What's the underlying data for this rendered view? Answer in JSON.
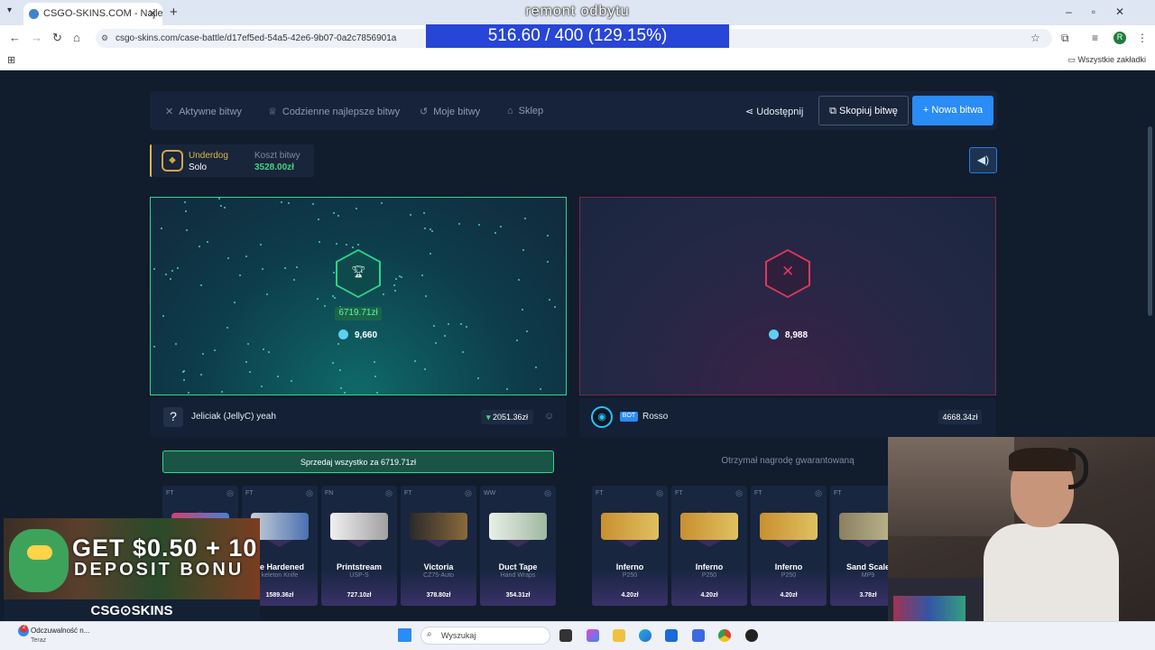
{
  "browser": {
    "tab_title": "CSGO-SKINS.COM - Najlepsze",
    "url": "csgo-skins.com/case-battle/d17ef5ed-54a5-42e6-9b07-0a2c7856901a",
    "bookmarks_label": "Wszystkie zakładki",
    "profile_initial": "R"
  },
  "overlay": {
    "title": "remont odbytu",
    "progress_text": "516.60 / 400 (129.15%)"
  },
  "nav": {
    "items": [
      "Aktywne bitwy",
      "Codzienne najlepsze bitwy",
      "Moje bitwy",
      "Sklep"
    ],
    "share": "Udostępnij",
    "copy": "Skopiuj bitwę",
    "new_battle": "Nowa bitwa"
  },
  "mode": {
    "title": "Underdog",
    "sub": "Solo",
    "cost_label": "Koszt bitwy",
    "cost_value": "3528.00zł"
  },
  "winner": {
    "amount": "6719.71zł",
    "coins": "9,660"
  },
  "loser": {
    "coins": "8,988"
  },
  "player1": {
    "avatar": "?",
    "name": "Jeliciak (JellyC) yeah",
    "value": "2051.36zł"
  },
  "player2": {
    "badge": "BOT",
    "name": "Rosso",
    "value": "4668.34zł"
  },
  "sell_all": "Sprzedaj wszystko za 6719.71zł",
  "guaranteed": "Otrzymał nagrodę gwarantowaną",
  "items_left": [
    {
      "cond": "FT",
      "name": "",
      "sub": "",
      "value": ""
    },
    {
      "cond": "FT",
      "name": "se Hardened",
      "sub": "keleton Knife",
      "value": "1589.36zł"
    },
    {
      "cond": "FN",
      "name": "Printstream",
      "sub": "USP-S",
      "value": "727.10zł"
    },
    {
      "cond": "FT",
      "name": "Victoria",
      "sub": "CZ75-Auto",
      "value": "378.80zł"
    },
    {
      "cond": "WW",
      "name": "Duct Tape",
      "sub": "Hand Wraps",
      "value": "354.31zł"
    }
  ],
  "items_right": [
    {
      "cond": "FT",
      "name": "Inferno",
      "sub": "P250",
      "value": "4.20zł"
    },
    {
      "cond": "FT",
      "name": "Inferno",
      "sub": "P250",
      "value": "4.20zł"
    },
    {
      "cond": "FT",
      "name": "Inferno",
      "sub": "P250",
      "value": "4.20zł"
    },
    {
      "cond": "FT",
      "name": "Sand Scale",
      "sub": "MP9",
      "value": "3.78zł"
    }
  ],
  "ad": {
    "line1": "GET $0.50 + 10",
    "line2": "DEPOSIT BONU",
    "logo": "CSG⊙SKINS"
  },
  "taskbar": {
    "notif_count": "2",
    "notif_title": "Odczuwalność n...",
    "notif_sub": "Teraz",
    "search_placeholder": "Wyszukaj"
  }
}
